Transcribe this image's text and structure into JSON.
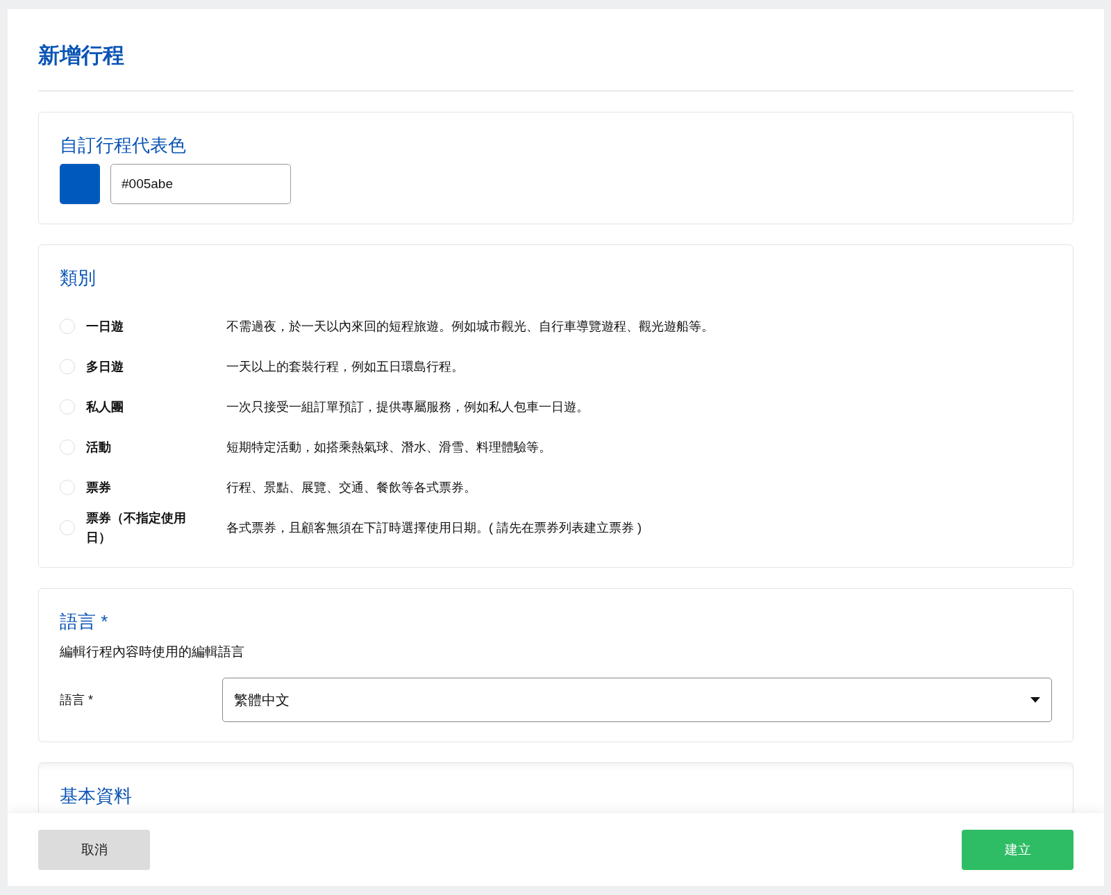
{
  "page": {
    "title": "新增行程"
  },
  "color_section": {
    "heading": "自訂行程代表色",
    "swatch": {
      "color": "#005abe"
    },
    "value": "#005abe"
  },
  "category_section": {
    "heading": "類別",
    "options": [
      {
        "label": "一日遊",
        "description": "不需過夜，於一天以內來回的短程旅遊。例如城市觀光、自行車導覽遊程、觀光遊船等。",
        "selected": false
      },
      {
        "label": "多日遊",
        "description": "一天以上的套裝行程，例如五日環島行程。",
        "selected": false
      },
      {
        "label": "私人團",
        "description": "一次只接受一組訂單預訂，提供專屬服務，例如私人包車一日遊。",
        "selected": false
      },
      {
        "label": "活動",
        "description": "短期特定活動，如搭乘熱氣球、潛水、滑雪、料理體驗等。",
        "selected": false
      },
      {
        "label": "票券",
        "description": "行程、景點、展覽、交通、餐飲等各式票券。",
        "selected": false
      },
      {
        "label": "票券（不指定使用日）",
        "description": "各式票券，且顧客無須在下訂時選擇使用日期。( 請先在票券列表建立票券 )",
        "selected": false
      }
    ]
  },
  "language_section": {
    "heading": "語言 *",
    "description": "編輯行程內容時使用的編輯語言",
    "field_label": "語言 *",
    "value": "繁體中文"
  },
  "basic_section": {
    "heading": "基本資料"
  },
  "footer": {
    "buttons": [
      {
        "kind": "secondary",
        "label": "取消"
      },
      {
        "kind": "primary",
        "label": "建立"
      }
    ]
  }
}
